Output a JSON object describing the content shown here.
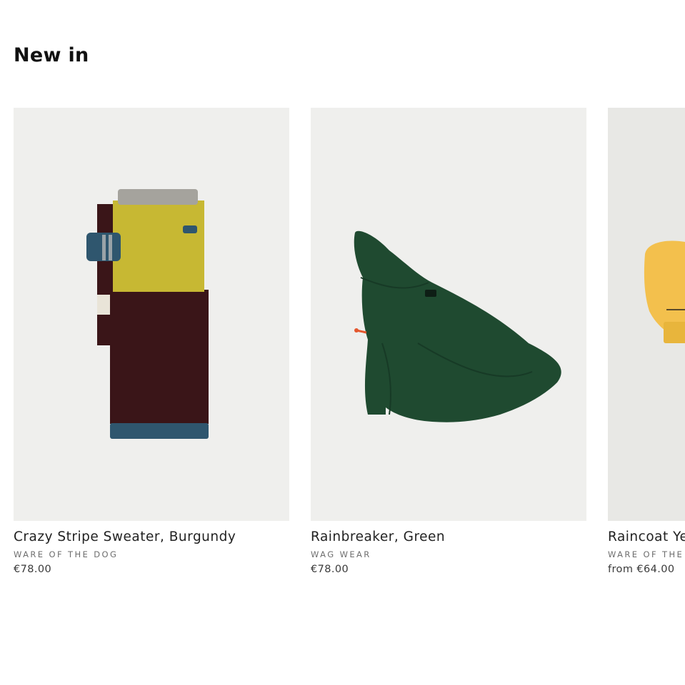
{
  "section": {
    "title": "New in"
  },
  "products": [
    {
      "title": "Crazy Stripe Sweater, Burgundy",
      "brand": "WARE OF THE DOG",
      "price": "€78.00",
      "image_icon": "knit-sweater-image"
    },
    {
      "title": "Rainbreaker, Green",
      "brand": "WAG WEAR",
      "price": "€78.00",
      "image_icon": "rain-jacket-image"
    },
    {
      "title": "Raincoat Yellow",
      "brand": "WARE OF THE DOG",
      "price": "from €64.00",
      "image_icon": "yellow-raincoat-image"
    }
  ],
  "colors": {
    "image_bg": "#efefed",
    "sweater_yellow": "#c7b833",
    "sweater_burgundy": "#3a1518",
    "sweater_teal": "#2f566e",
    "sweater_grey": "#a5a39d",
    "jacket_green": "#1f4a30",
    "raincoat_yellow": "#f3c04d"
  }
}
